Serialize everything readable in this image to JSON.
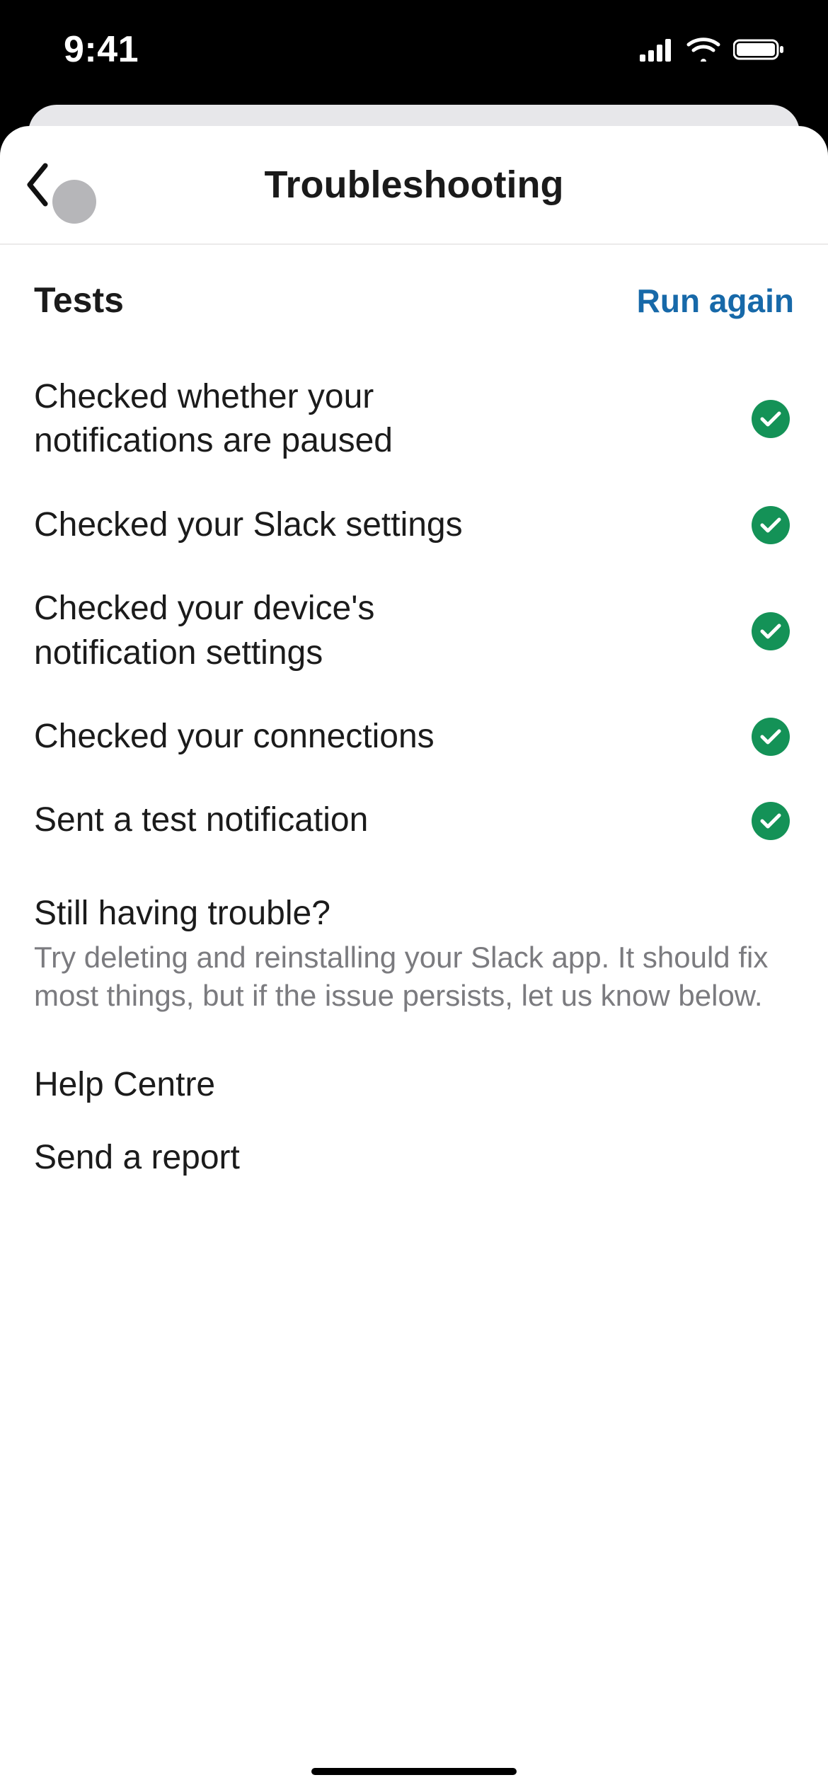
{
  "status_bar": {
    "time": "9:41"
  },
  "header": {
    "title": "Troubleshooting"
  },
  "tests_section": {
    "title": "Tests",
    "run_again_label": "Run again",
    "items": [
      {
        "label": "Checked whether your notifications are paused",
        "status": "pass"
      },
      {
        "label": "Checked your Slack settings",
        "status": "pass"
      },
      {
        "label": "Checked your device's notification settings",
        "status": "pass"
      },
      {
        "label": "Checked your connections",
        "status": "pass"
      },
      {
        "label": "Sent a test notification",
        "status": "pass"
      }
    ]
  },
  "trouble": {
    "title": "Still having trouble?",
    "body": "Try deleting and reinstalling your Slack app. It should fix most things, but if the issue persists, let us know below."
  },
  "actions": {
    "help_centre_label": "Help Centre",
    "send_report_label": "Send a report"
  },
  "colors": {
    "link": "#1769a9",
    "success": "#149257"
  }
}
